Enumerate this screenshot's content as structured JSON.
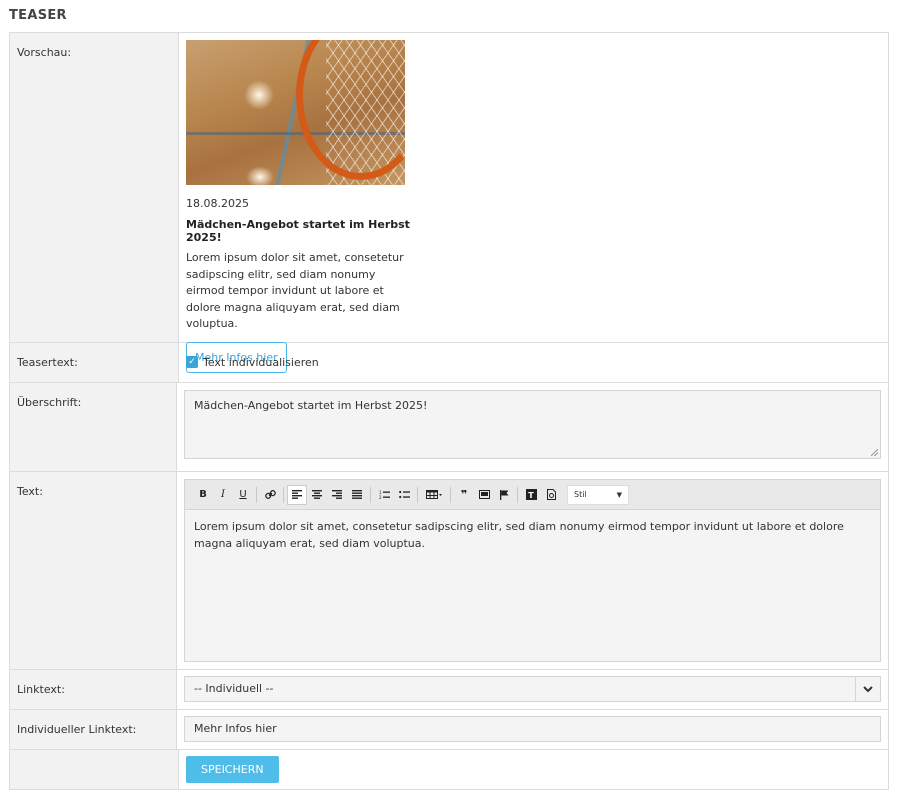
{
  "section_title": "TEASER",
  "rows": {
    "preview": {
      "label": "Vorschau:",
      "date": "18.08.2025",
      "heading": "Mädchen-Angebot startet im Herbst 2025!",
      "text": "Lorem ipsum dolor sit amet, consetetur sadipscing elitr, sed diam nonumy eirmod tempor invidunt ut labore et dolore magna aliquyam erat, sed diam voluptua.",
      "button_label": "Mehr Infos hier"
    },
    "teasertext": {
      "label": "Teasertext:",
      "checkbox_label": "Text individualisieren",
      "checked": true
    },
    "heading": {
      "label": "Überschrift:",
      "value": "Mädchen-Angebot startet im Herbst 2025!"
    },
    "text": {
      "label": "Text:",
      "style_select": "Stil",
      "content": "Lorem ipsum dolor sit amet, consetetur sadipscing elitr, sed diam nonumy eirmod tempor invidunt ut labore et dolore magna aliquyam erat, sed diam voluptua."
    },
    "linktext": {
      "label": "Linktext:",
      "selected": "-- Individuell --"
    },
    "custom_linktext": {
      "label": "Individueller Linktext:",
      "value": "Mehr Infos hier"
    },
    "save": {
      "button_label": "SPEICHERN"
    }
  },
  "toolbar": {
    "bold": "B",
    "italic": "I",
    "underline": "U",
    "quote": "❞"
  },
  "colors": {
    "accent": "#4fbde9",
    "label_bg": "#f2f2f2",
    "field_bg": "#f4f4f4"
  }
}
